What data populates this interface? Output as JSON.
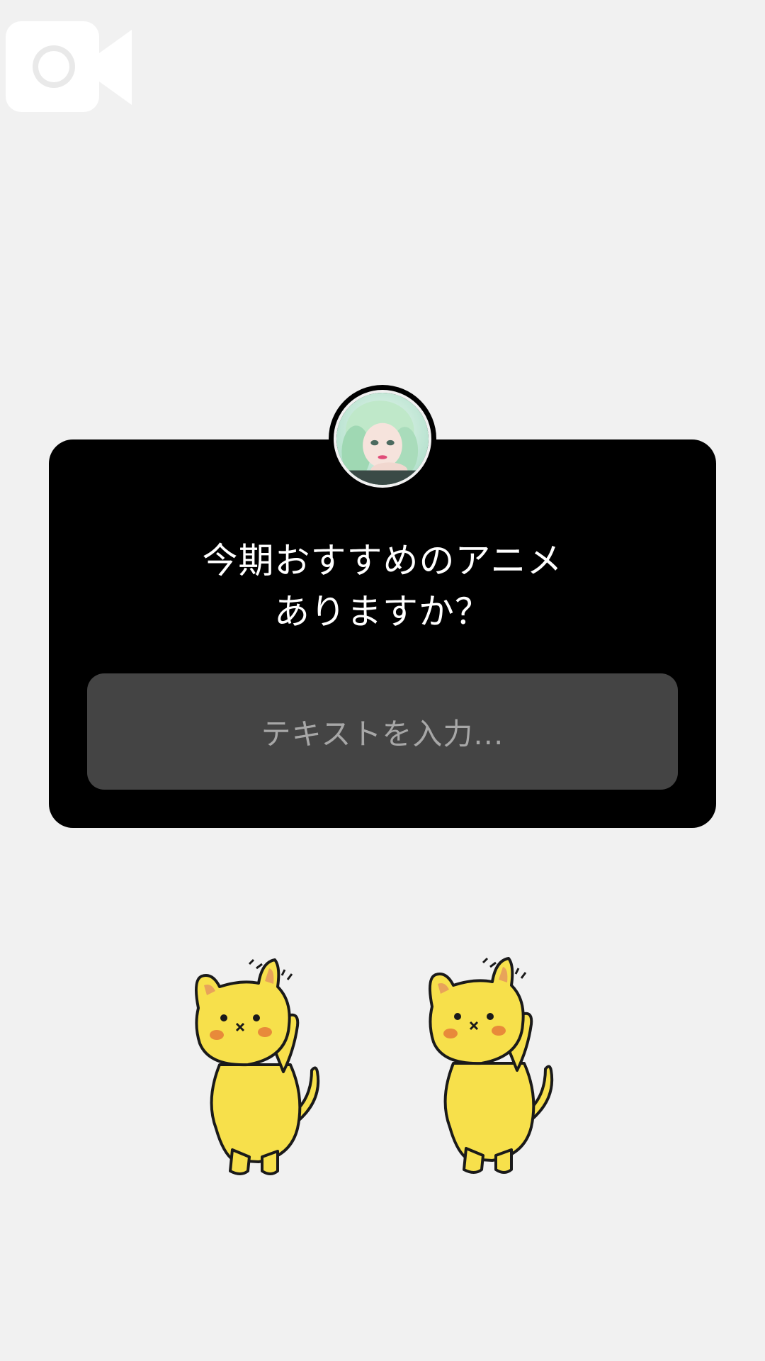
{
  "icons": {
    "camera": "video-camera-icon",
    "avatar": "profile-photo"
  },
  "question": {
    "line1": "今期おすすめのアニメ",
    "line2": "ありますか？"
  },
  "answer": {
    "placeholder": "テキストを入力..."
  },
  "colors": {
    "background": "#f1f1f1",
    "card": "#000000",
    "field": "#444444",
    "cat": "#f7e04b"
  }
}
